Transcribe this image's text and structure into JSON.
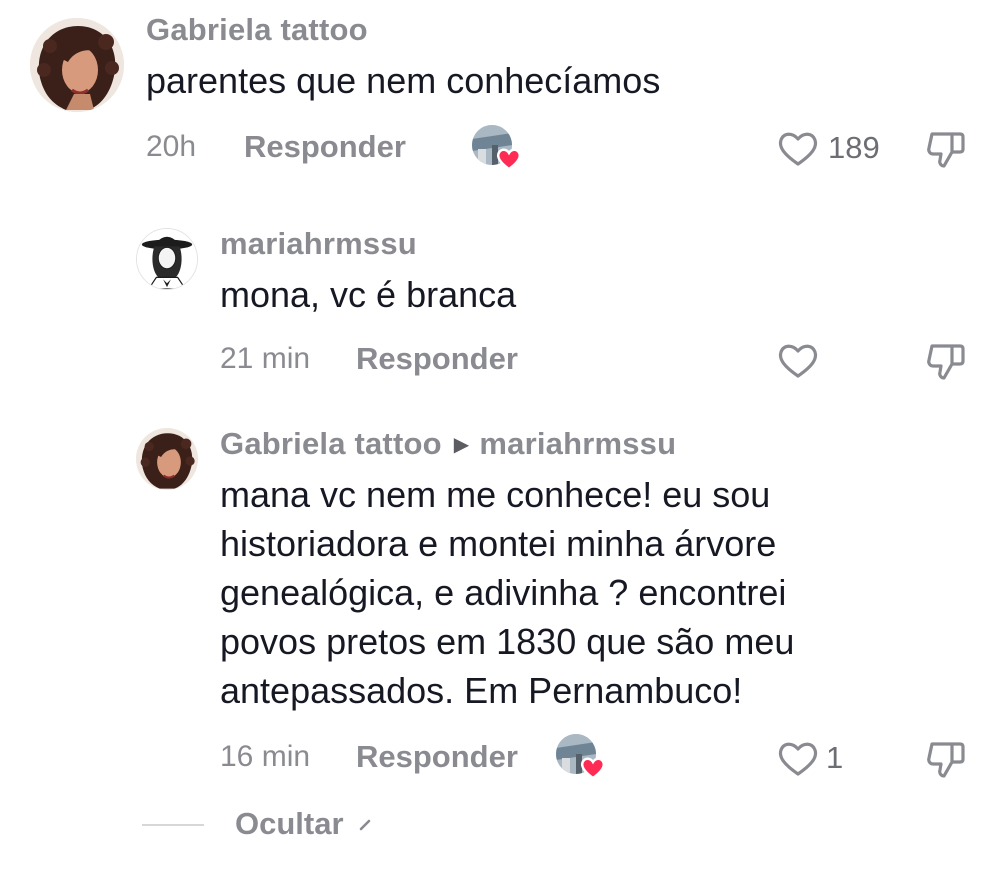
{
  "comments": [
    {
      "username": "Gabriela tattoo",
      "text": "parentes que nem conhecíamos",
      "time": "20h",
      "reply_label": "Responder",
      "like_count": "189",
      "avatar_icon": "curly-hair-woman-avatar",
      "creator_liked": true
    },
    {
      "username": "mariahrmssu",
      "text": "mona, vc é branca",
      "time": "21 min",
      "reply_label": "Responder",
      "like_count": "",
      "avatar_icon": "hat-woman-illustration-avatar",
      "creator_liked": false
    },
    {
      "username": "Gabriela tattoo",
      "reply_to": "mariahrmssu",
      "text_lines": [
        "mana vc nem me conhece! eu sou",
        "historiadora e montei minha árvore",
        "genealógica, e adivinha ? encontrei",
        "povos pretos em 1830 que são meu",
        "antepassados. Em Pernambuco!"
      ],
      "time": "16 min",
      "reply_label": "Responder",
      "like_count": "1",
      "avatar_icon": "curly-hair-woman-avatar",
      "creator_liked": true
    }
  ],
  "footer": {
    "hide_label": "Ocultar"
  },
  "colors": {
    "secondary_text": "#8a8b91",
    "primary_text": "#161823",
    "heart_badge": "#fe2c55"
  }
}
